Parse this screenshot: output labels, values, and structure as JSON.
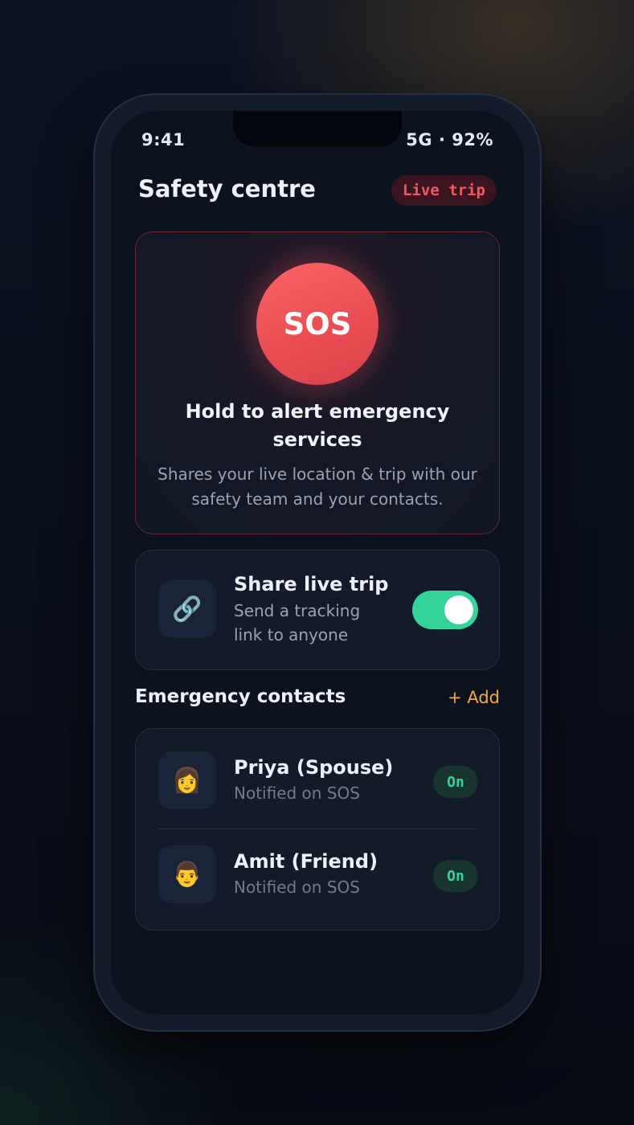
{
  "status_bar": {
    "time": "9:41",
    "network_battery": "5G · 92%"
  },
  "header": {
    "title": "Safety centre",
    "badge": "Live trip"
  },
  "sos": {
    "button_label": "SOS",
    "title": "Hold to alert emergency services",
    "description": "Shares your live location & trip with our safety team and your contacts."
  },
  "share_trip": {
    "icon": "🔗",
    "title": "Share live trip",
    "description": "Send a tracking link to anyone",
    "enabled": true
  },
  "contacts": {
    "section_title": "Emergency contacts",
    "add_label": "+ Add",
    "items": [
      {
        "avatar": "👩",
        "name": "Priya (Spouse)",
        "subtitle": "Notified on SOS",
        "status": "On"
      },
      {
        "avatar": "👨",
        "name": "Amit (Friend)",
        "subtitle": "Notified on SOS",
        "status": "On"
      }
    ]
  },
  "colors": {
    "accent_red": "#e84c52",
    "accent_green": "#34d399",
    "accent_orange": "#f2a93b",
    "background": "#0c121e"
  }
}
